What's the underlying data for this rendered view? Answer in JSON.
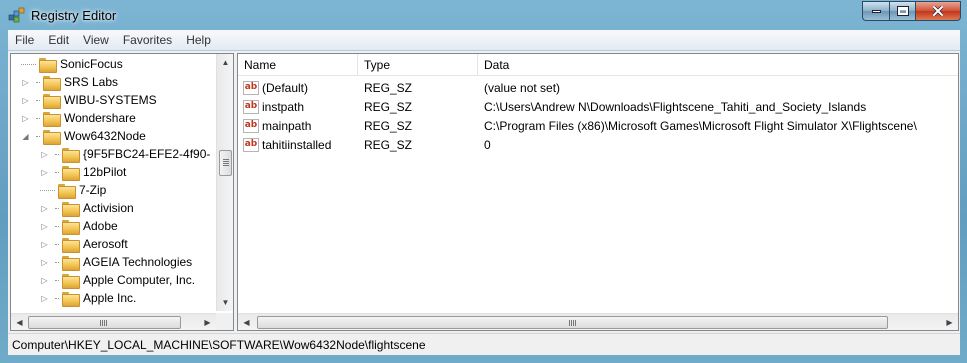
{
  "window": {
    "title": "Registry Editor"
  },
  "caption_buttons": {
    "minimize_icon": "minimize-icon",
    "maximize_icon": "maximize-icon",
    "close_icon": "close-icon"
  },
  "menu": [
    "File",
    "Edit",
    "View",
    "Favorites",
    "Help"
  ],
  "tree": {
    "items": [
      {
        "label": "SonicFocus",
        "expandable": false
      },
      {
        "label": "SRS Labs",
        "expandable": true
      },
      {
        "label": "WIBU-SYSTEMS",
        "expandable": true
      },
      {
        "label": "Wondershare",
        "expandable": true
      },
      {
        "label": "Wow6432Node",
        "expandable": true,
        "expanded": true
      },
      {
        "label": "{9F5FBC24-EFE2-4f90-",
        "expandable": true
      },
      {
        "label": "12bPilot",
        "expandable": true
      },
      {
        "label": "7-Zip",
        "expandable": false
      },
      {
        "label": "Activision",
        "expandable": true
      },
      {
        "label": "Adobe",
        "expandable": true
      },
      {
        "label": "Aerosoft",
        "expandable": true
      },
      {
        "label": "AGEIA Technologies",
        "expandable": true
      },
      {
        "label": "Apple Computer, Inc.",
        "expandable": true
      },
      {
        "label": "Apple Inc.",
        "expandable": true
      }
    ]
  },
  "list": {
    "columns": [
      "Name",
      "Type",
      "Data"
    ],
    "rows": [
      {
        "name": "(Default)",
        "type": "REG_SZ",
        "data": "(value not set)",
        "icon": "string-value-icon"
      },
      {
        "name": "instpath",
        "type": "REG_SZ",
        "data": "C:\\Users\\Andrew N\\Downloads\\Flightscene_Tahiti_and_Society_Islands",
        "icon": "string-value-icon"
      },
      {
        "name": "mainpath",
        "type": "REG_SZ",
        "data": "C:\\Program Files (x86)\\Microsoft Games\\Microsoft Flight Simulator X\\Flightscene\\",
        "icon": "string-value-icon"
      },
      {
        "name": "tahitiinstalled",
        "type": "REG_SZ",
        "data": "0",
        "icon": "string-value-icon"
      }
    ],
    "value_icon_text": "ab"
  },
  "statusbar": {
    "path": "Computer\\HKEY_LOCAL_MACHINE\\SOFTWARE\\Wow6432Node\\flightscene"
  },
  "colors": {
    "string_icon": "#c2361b",
    "close_button": "#c2361b",
    "folder": "#f2c14d"
  }
}
